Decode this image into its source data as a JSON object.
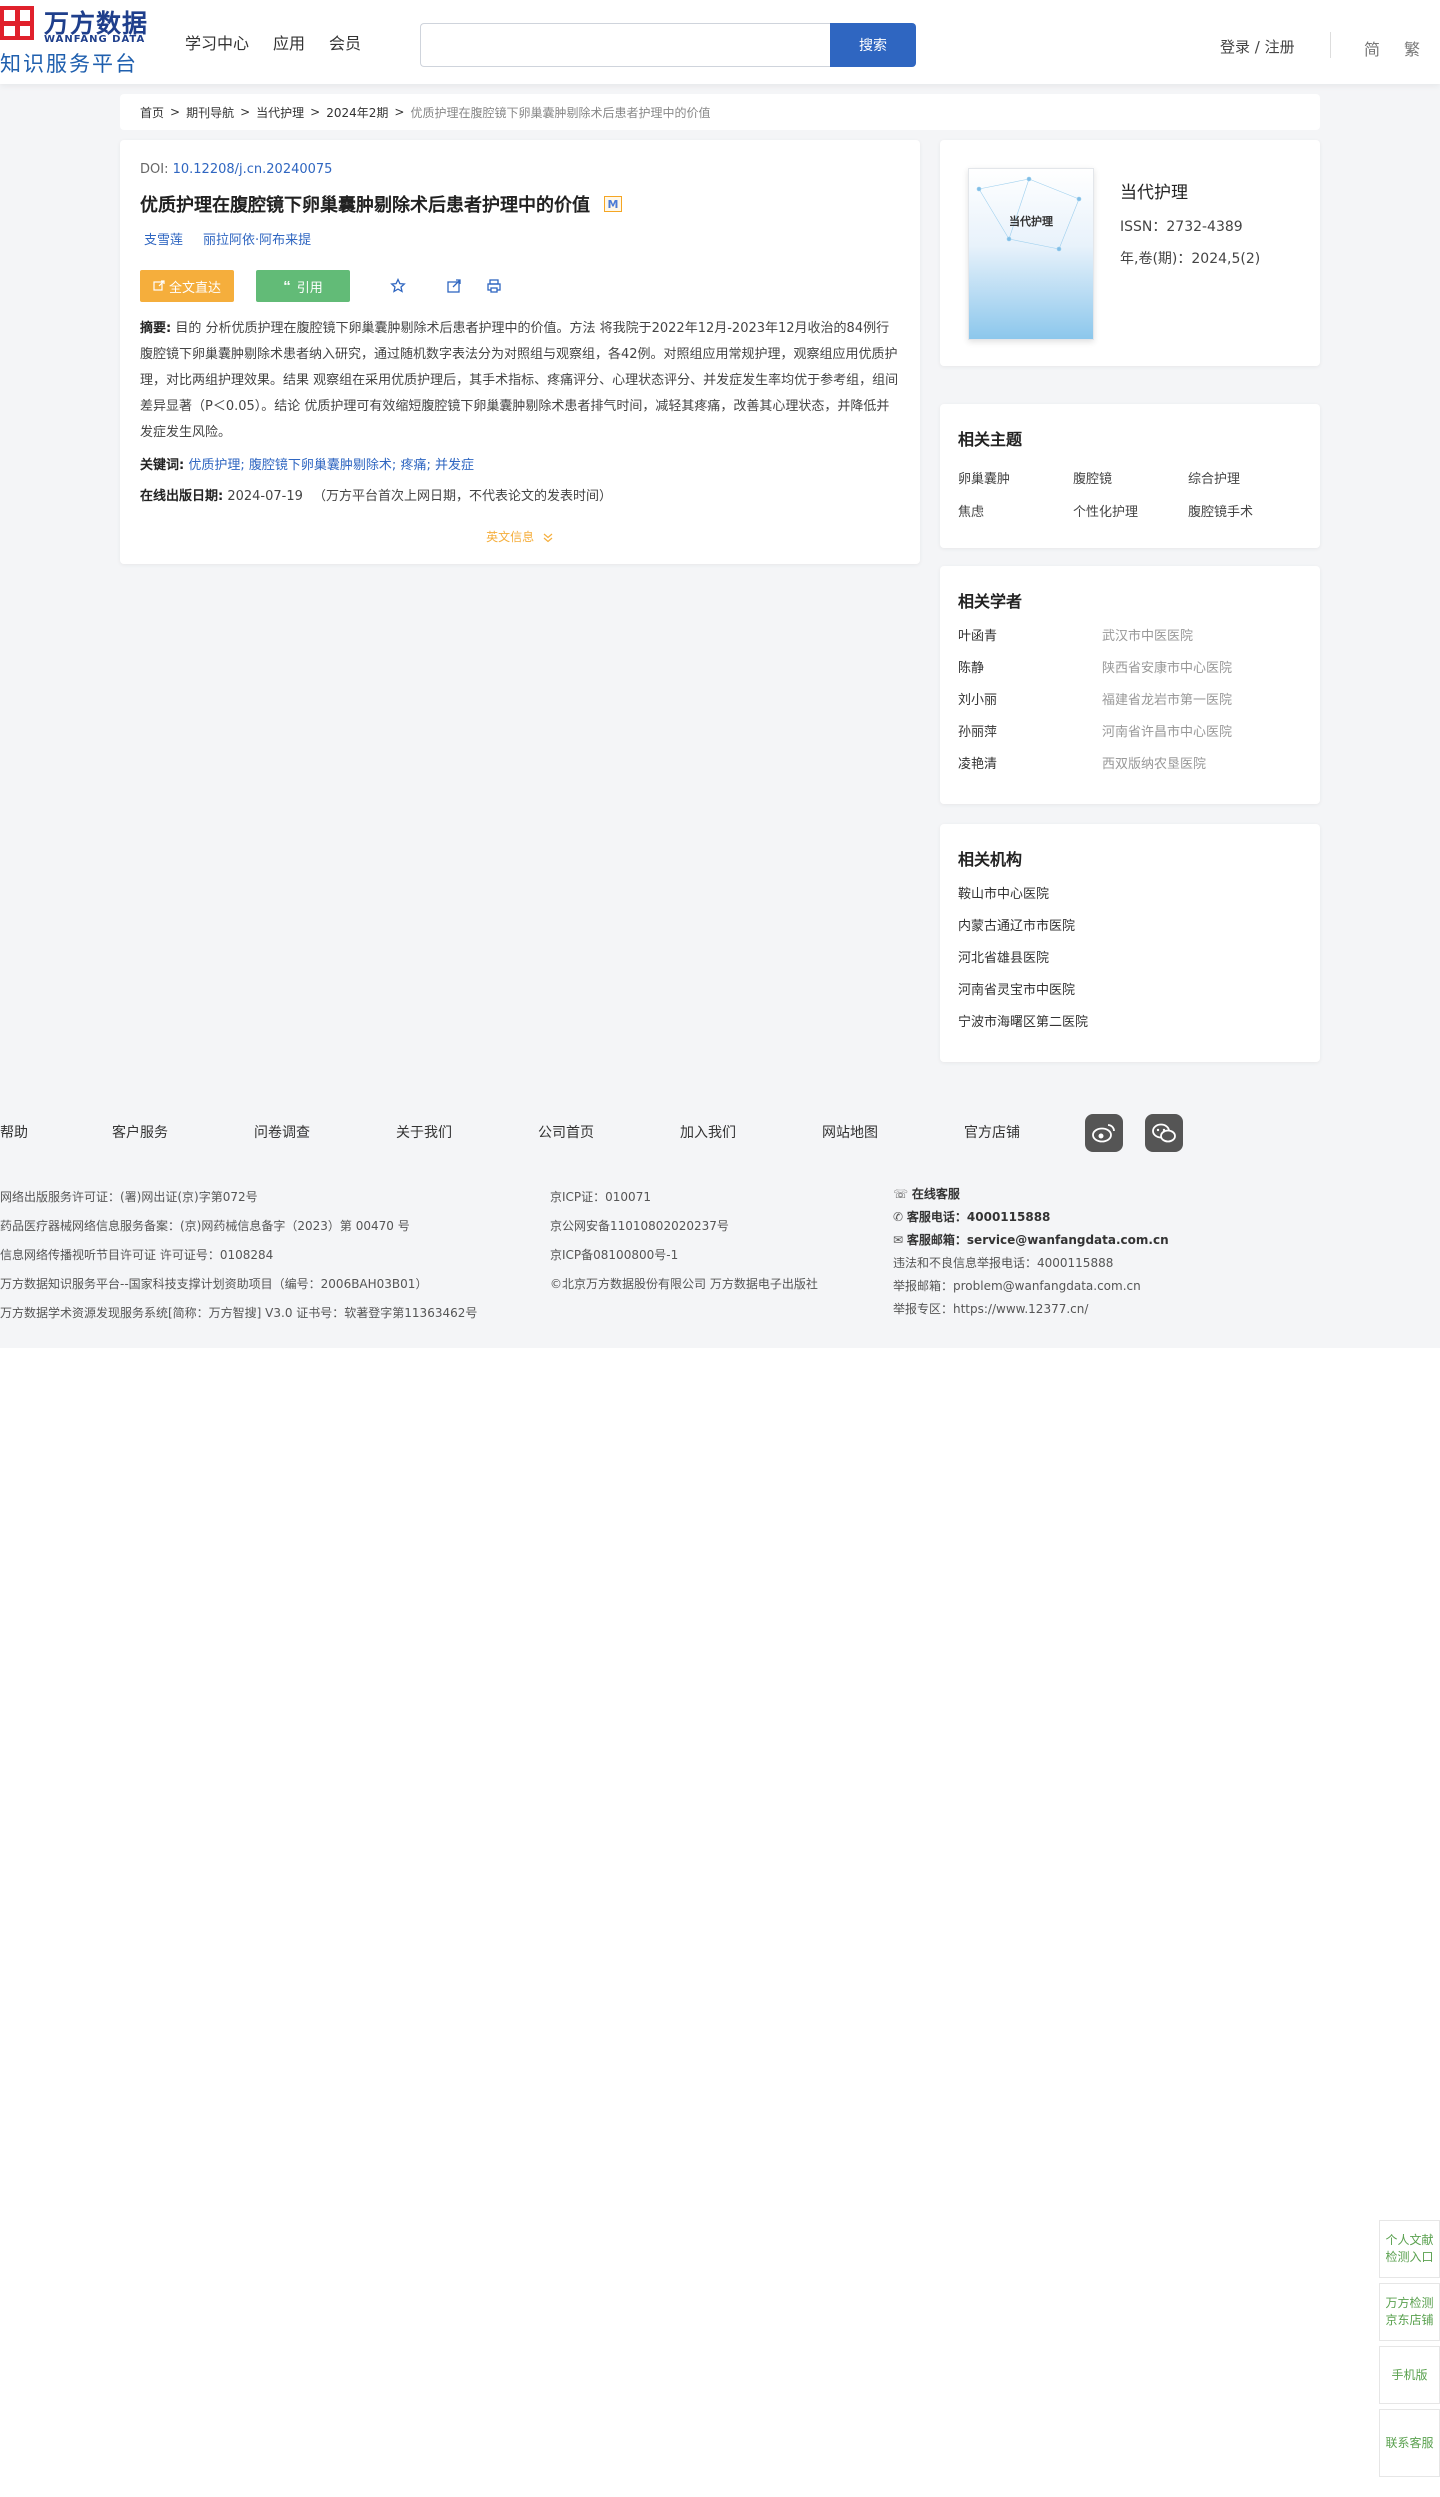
{
  "logo": {
    "cn": "万方数据",
    "en": "WANFANG DATA",
    "sub": "知识服务平台"
  },
  "nav": [
    "学习中心",
    "应用",
    "会员"
  ],
  "search": {
    "placeholder": "",
    "button": "搜索"
  },
  "auth": "登录 / 注册",
  "lang": [
    "简",
    "繁"
  ],
  "breadcrumb": [
    "首页",
    "期刊导航",
    "当代护理",
    "2024年2期",
    "优质护理在腹腔镜下卵巢囊肿剔除术后患者护理中的价值"
  ],
  "article": {
    "doi_label": "DOI:",
    "doi": "10.12208/j.cn.20240075",
    "title": "优质护理在腹腔镜下卵巢囊肿剔除术后患者护理中的价值",
    "badge": "M",
    "authors": [
      "支雪莲",
      "丽拉阿依·阿布来提"
    ],
    "btn_full": "全文直达",
    "btn_cite": "引用",
    "abstract_label": "摘要:",
    "abstract": "目的 分析优质护理在腹腔镜下卵巢囊肿剔除术后患者护理中的价值。方法 将我院于2022年12月-2023年12月收治的84例行腹腔镜下卵巢囊肿剔除术患者纳入研究，通过随机数字表法分为对照组与观察组，各42例。对照组应用常规护理，观察组应用优质护理，对比两组护理效果。结果 观察组在采用优质护理后，其手术指标、疼痛评分、心理状态评分、并发症发生率均优于参考组，组间差异显著（P＜0.05）。结论 优质护理可有效缩短腹腔镜下卵巢囊肿剔除术患者排气时间，减轻其疼痛，改善其心理状态，并降低并发症发生风险。",
    "keywords_label": "关键词:",
    "keywords": [
      "优质护理",
      "腹腔镜下卵巢囊肿剔除术",
      "疼痛",
      "并发症"
    ],
    "pubdate_label": "在线出版日期:",
    "pubdate": "2024-07-19",
    "pubdate_note": "（万方平台首次上网日期，不代表论文的发表时间）",
    "english_info": "英文信息"
  },
  "journal": {
    "cover_title": "当代护理",
    "name": "当代护理",
    "issn": "ISSN：2732-4389",
    "volume": "年,卷(期)：2024,5(2)"
  },
  "topics": {
    "title": "相关主题",
    "items": [
      "卵巢囊肿",
      "腹腔镜",
      "综合护理",
      "焦虑",
      "个性化护理",
      "腹腔镜手术"
    ]
  },
  "scholars": {
    "title": "相关学者",
    "items": [
      {
        "name": "叶函青",
        "inst": "武汉市中医医院"
      },
      {
        "name": "陈静",
        "inst": "陕西省安康市中心医院"
      },
      {
        "name": "刘小丽",
        "inst": "福建省龙岩市第一医院"
      },
      {
        "name": "孙丽萍",
        "inst": "河南省许昌市中心医院"
      },
      {
        "name": "凌艳清",
        "inst": "西双版纳农垦医院"
      }
    ]
  },
  "orgs": {
    "title": "相关机构",
    "items": [
      "鞍山市中心医院",
      "内蒙古通辽市市医院",
      "河北省雄县医院",
      "河南省灵宝市中医院",
      "宁波市海曙区第二医院"
    ]
  },
  "footer": {
    "links": [
      "帮助",
      "客户服务",
      "问卷调查",
      "关于我们",
      "公司首页",
      "加入我们",
      "网站地图",
      "官方店铺"
    ],
    "col1": [
      "网络出版服务许可证：(署)网出证(京)字第072号",
      "药品医疗器械网络信息服务备案：(京)网药械信息备字（2023）第 00470 号",
      "信息网络传播视听节目许可证 许可证号：0108284",
      "万方数据知识服务平台--国家科技支撑计划资助项目（编号：2006BAH03B01）",
      "万方数据学术资源发现服务系统[简称：万方智搜] V3.0 证书号：软著登字第11363462号"
    ],
    "col2": [
      "京ICP证：010071",
      "京公网安备11010802020237号",
      "京ICP备08100800号-1",
      "©北京万方数据股份有限公司 万方数据电子出版社"
    ],
    "online_service": "在线客服",
    "phone_label": "客服电话：",
    "phone": "4000115888",
    "email_label": "客服邮箱：",
    "email": "service@wanfangdata.com.cn",
    "report_phone": "违法和不良信息举报电话：4000115888",
    "report_email": "举报邮箱：problem@wanfangdata.com.cn",
    "report_zone": "举报专区：https://www.12377.cn/"
  },
  "side": {
    "personal": "个人文献检测入口",
    "jd": "万方检测京东店铺",
    "mobile": "手机版",
    "contact": "联系客服"
  }
}
